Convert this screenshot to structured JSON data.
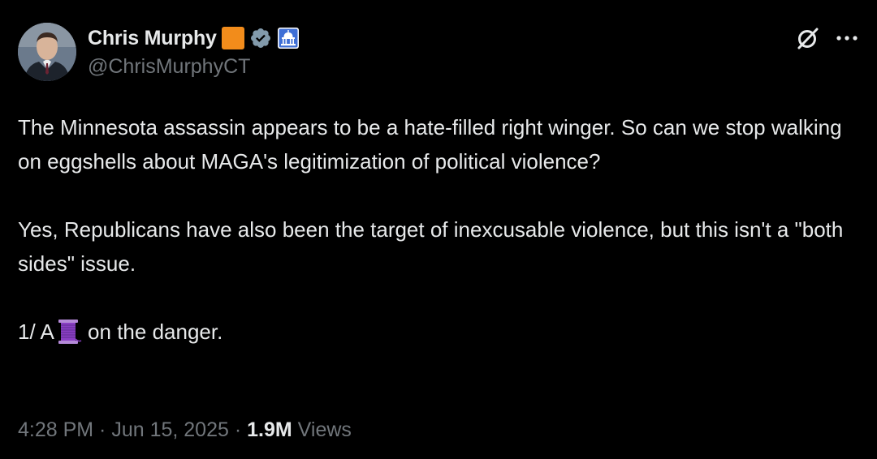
{
  "author": {
    "display_name": "Chris Murphy",
    "handle": "@ChrisMurphyCT",
    "badges": [
      "orange-square-badge",
      "verified-icon",
      "capitol-building-icon"
    ]
  },
  "actions": {
    "grok_icon": "grok-icon",
    "more_icon": "more-icon"
  },
  "tweet": {
    "paragraph1": "The Minnesota assassin appears to be a hate-filled right winger. So can we stop walking on eggshells about MAGA's legitimization of political violence?",
    "paragraph2": "Yes, Republicans have also been the target of inexcusable violence, but this isn't a \"both sides\" issue.",
    "paragraph3_prefix": "1/ A",
    "paragraph3_emoji": "spool-of-thread-icon",
    "paragraph3_suffix": " on the danger."
  },
  "meta": {
    "time": "4:28 PM",
    "separator1": " · ",
    "date": "Jun 15, 2025",
    "separator2": " · ",
    "views_count": "1.9M",
    "views_label": " Views"
  },
  "colors": {
    "background": "#000000",
    "text_primary": "#e7e9ea",
    "text_secondary": "#71767b",
    "badge_orange": "#f28c1b",
    "verified_blue": "#829aab"
  }
}
